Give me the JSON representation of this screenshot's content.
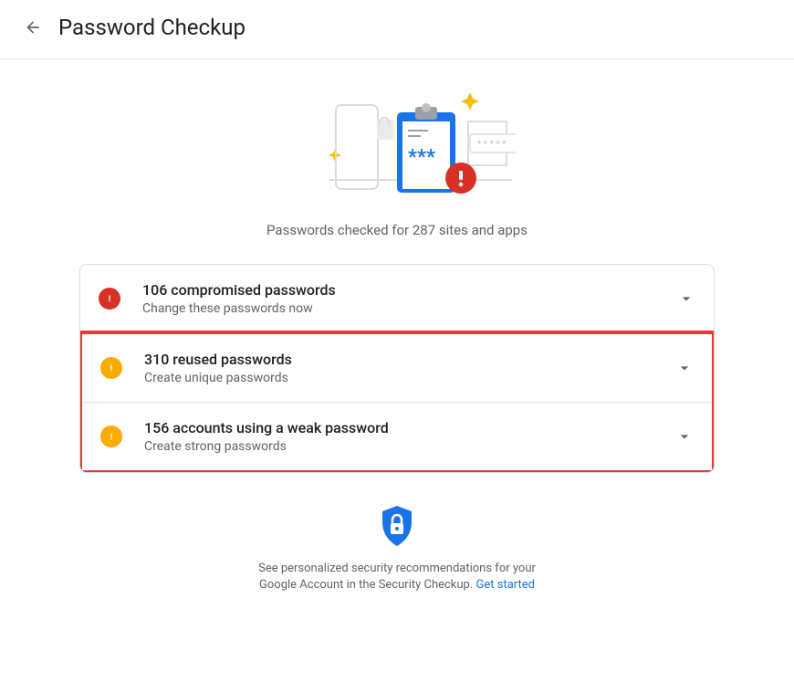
{
  "header": {
    "title": "Password Checkup"
  },
  "summary": "Passwords checked for 287 sites and apps",
  "cards": {
    "compromised": {
      "title": "106 compromised passwords",
      "subtitle": "Change these passwords now"
    },
    "reused": {
      "title": "310 reused passwords",
      "subtitle": "Create unique passwords"
    },
    "weak": {
      "title": "156 accounts using a weak password",
      "subtitle": "Create strong passwords"
    }
  },
  "footer": {
    "text": "See personalized security recommendations for your Google Account in the Security Checkup. ",
    "link": "Get started"
  }
}
